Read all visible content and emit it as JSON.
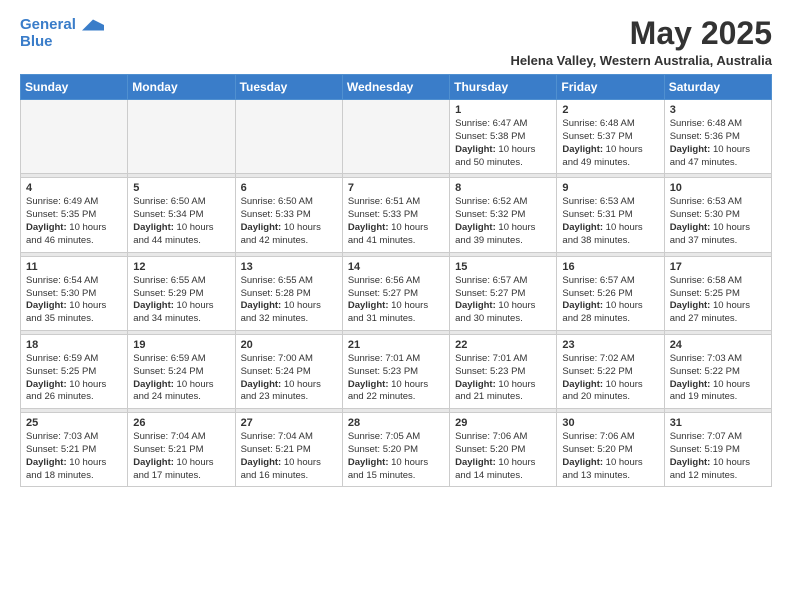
{
  "logo": {
    "line1": "General",
    "line2": "Blue"
  },
  "title": "May 2025",
  "subtitle": "Helena Valley, Western Australia, Australia",
  "days_of_week": [
    "Sunday",
    "Monday",
    "Tuesday",
    "Wednesday",
    "Thursday",
    "Friday",
    "Saturday"
  ],
  "weeks": [
    [
      {
        "day": "",
        "sunrise": "",
        "sunset": "",
        "daylight": "",
        "empty": true
      },
      {
        "day": "",
        "sunrise": "",
        "sunset": "",
        "daylight": "",
        "empty": true
      },
      {
        "day": "",
        "sunrise": "",
        "sunset": "",
        "daylight": "",
        "empty": true
      },
      {
        "day": "",
        "sunrise": "",
        "sunset": "",
        "daylight": "",
        "empty": true
      },
      {
        "day": "1",
        "sunrise": "Sunrise: 6:47 AM",
        "sunset": "Sunset: 5:38 PM",
        "daylight": "Daylight: 10 hours and 50 minutes.",
        "empty": false
      },
      {
        "day": "2",
        "sunrise": "Sunrise: 6:48 AM",
        "sunset": "Sunset: 5:37 PM",
        "daylight": "Daylight: 10 hours and 49 minutes.",
        "empty": false
      },
      {
        "day": "3",
        "sunrise": "Sunrise: 6:48 AM",
        "sunset": "Sunset: 5:36 PM",
        "daylight": "Daylight: 10 hours and 47 minutes.",
        "empty": false
      }
    ],
    [
      {
        "day": "4",
        "sunrise": "Sunrise: 6:49 AM",
        "sunset": "Sunset: 5:35 PM",
        "daylight": "Daylight: 10 hours and 46 minutes.",
        "empty": false
      },
      {
        "day": "5",
        "sunrise": "Sunrise: 6:50 AM",
        "sunset": "Sunset: 5:34 PM",
        "daylight": "Daylight: 10 hours and 44 minutes.",
        "empty": false
      },
      {
        "day": "6",
        "sunrise": "Sunrise: 6:50 AM",
        "sunset": "Sunset: 5:33 PM",
        "daylight": "Daylight: 10 hours and 42 minutes.",
        "empty": false
      },
      {
        "day": "7",
        "sunrise": "Sunrise: 6:51 AM",
        "sunset": "Sunset: 5:33 PM",
        "daylight": "Daylight: 10 hours and 41 minutes.",
        "empty": false
      },
      {
        "day": "8",
        "sunrise": "Sunrise: 6:52 AM",
        "sunset": "Sunset: 5:32 PM",
        "daylight": "Daylight: 10 hours and 39 minutes.",
        "empty": false
      },
      {
        "day": "9",
        "sunrise": "Sunrise: 6:53 AM",
        "sunset": "Sunset: 5:31 PM",
        "daylight": "Daylight: 10 hours and 38 minutes.",
        "empty": false
      },
      {
        "day": "10",
        "sunrise": "Sunrise: 6:53 AM",
        "sunset": "Sunset: 5:30 PM",
        "daylight": "Daylight: 10 hours and 37 minutes.",
        "empty": false
      }
    ],
    [
      {
        "day": "11",
        "sunrise": "Sunrise: 6:54 AM",
        "sunset": "Sunset: 5:30 PM",
        "daylight": "Daylight: 10 hours and 35 minutes.",
        "empty": false
      },
      {
        "day": "12",
        "sunrise": "Sunrise: 6:55 AM",
        "sunset": "Sunset: 5:29 PM",
        "daylight": "Daylight: 10 hours and 34 minutes.",
        "empty": false
      },
      {
        "day": "13",
        "sunrise": "Sunrise: 6:55 AM",
        "sunset": "Sunset: 5:28 PM",
        "daylight": "Daylight: 10 hours and 32 minutes.",
        "empty": false
      },
      {
        "day": "14",
        "sunrise": "Sunrise: 6:56 AM",
        "sunset": "Sunset: 5:27 PM",
        "daylight": "Daylight: 10 hours and 31 minutes.",
        "empty": false
      },
      {
        "day": "15",
        "sunrise": "Sunrise: 6:57 AM",
        "sunset": "Sunset: 5:27 PM",
        "daylight": "Daylight: 10 hours and 30 minutes.",
        "empty": false
      },
      {
        "day": "16",
        "sunrise": "Sunrise: 6:57 AM",
        "sunset": "Sunset: 5:26 PM",
        "daylight": "Daylight: 10 hours and 28 minutes.",
        "empty": false
      },
      {
        "day": "17",
        "sunrise": "Sunrise: 6:58 AM",
        "sunset": "Sunset: 5:25 PM",
        "daylight": "Daylight: 10 hours and 27 minutes.",
        "empty": false
      }
    ],
    [
      {
        "day": "18",
        "sunrise": "Sunrise: 6:59 AM",
        "sunset": "Sunset: 5:25 PM",
        "daylight": "Daylight: 10 hours and 26 minutes.",
        "empty": false
      },
      {
        "day": "19",
        "sunrise": "Sunrise: 6:59 AM",
        "sunset": "Sunset: 5:24 PM",
        "daylight": "Daylight: 10 hours and 24 minutes.",
        "empty": false
      },
      {
        "day": "20",
        "sunrise": "Sunrise: 7:00 AM",
        "sunset": "Sunset: 5:24 PM",
        "daylight": "Daylight: 10 hours and 23 minutes.",
        "empty": false
      },
      {
        "day": "21",
        "sunrise": "Sunrise: 7:01 AM",
        "sunset": "Sunset: 5:23 PM",
        "daylight": "Daylight: 10 hours and 22 minutes.",
        "empty": false
      },
      {
        "day": "22",
        "sunrise": "Sunrise: 7:01 AM",
        "sunset": "Sunset: 5:23 PM",
        "daylight": "Daylight: 10 hours and 21 minutes.",
        "empty": false
      },
      {
        "day": "23",
        "sunrise": "Sunrise: 7:02 AM",
        "sunset": "Sunset: 5:22 PM",
        "daylight": "Daylight: 10 hours and 20 minutes.",
        "empty": false
      },
      {
        "day": "24",
        "sunrise": "Sunrise: 7:03 AM",
        "sunset": "Sunset: 5:22 PM",
        "daylight": "Daylight: 10 hours and 19 minutes.",
        "empty": false
      }
    ],
    [
      {
        "day": "25",
        "sunrise": "Sunrise: 7:03 AM",
        "sunset": "Sunset: 5:21 PM",
        "daylight": "Daylight: 10 hours and 18 minutes.",
        "empty": false
      },
      {
        "day": "26",
        "sunrise": "Sunrise: 7:04 AM",
        "sunset": "Sunset: 5:21 PM",
        "daylight": "Daylight: 10 hours and 17 minutes.",
        "empty": false
      },
      {
        "day": "27",
        "sunrise": "Sunrise: 7:04 AM",
        "sunset": "Sunset: 5:21 PM",
        "daylight": "Daylight: 10 hours and 16 minutes.",
        "empty": false
      },
      {
        "day": "28",
        "sunrise": "Sunrise: 7:05 AM",
        "sunset": "Sunset: 5:20 PM",
        "daylight": "Daylight: 10 hours and 15 minutes.",
        "empty": false
      },
      {
        "day": "29",
        "sunrise": "Sunrise: 7:06 AM",
        "sunset": "Sunset: 5:20 PM",
        "daylight": "Daylight: 10 hours and 14 minutes.",
        "empty": false
      },
      {
        "day": "30",
        "sunrise": "Sunrise: 7:06 AM",
        "sunset": "Sunset: 5:20 PM",
        "daylight": "Daylight: 10 hours and 13 minutes.",
        "empty": false
      },
      {
        "day": "31",
        "sunrise": "Sunrise: 7:07 AM",
        "sunset": "Sunset: 5:19 PM",
        "daylight": "Daylight: 10 hours and 12 minutes.",
        "empty": false
      }
    ]
  ]
}
